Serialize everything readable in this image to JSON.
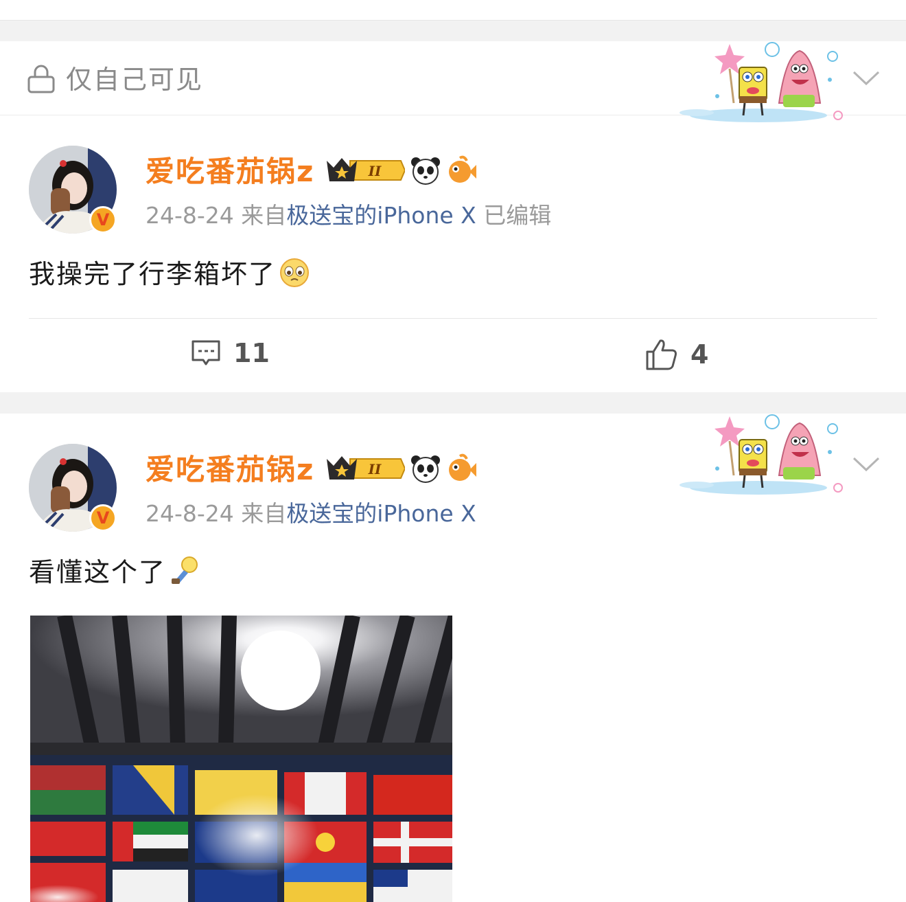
{
  "privacy": {
    "label": "仅自己可见"
  },
  "posts": [
    {
      "username": "爱吃番茄锅z",
      "date": "24-8-24",
      "source_prefix": "来自",
      "source": "极送宝的iPhone X",
      "edited": "已编辑",
      "text": "我操完了行李箱坏了",
      "comments": "11",
      "likes": "4"
    },
    {
      "username": "爱吃番茄锅z",
      "date": "24-8-24",
      "source_prefix": "来自",
      "source": "极送宝的iPhone X",
      "text": "看懂这个了"
    }
  ],
  "badge": {
    "level": "II",
    "verified": "V"
  },
  "colors": {
    "username": "#f47e1f",
    "source": "#49679a",
    "badge_gold": "#f5a623"
  },
  "icons": [
    "lock-icon",
    "chevron-down-icon",
    "comment-icon",
    "thumbs-up-icon",
    "crown-badge-icon",
    "panda-icon",
    "fish-icon",
    "verified-icon"
  ]
}
